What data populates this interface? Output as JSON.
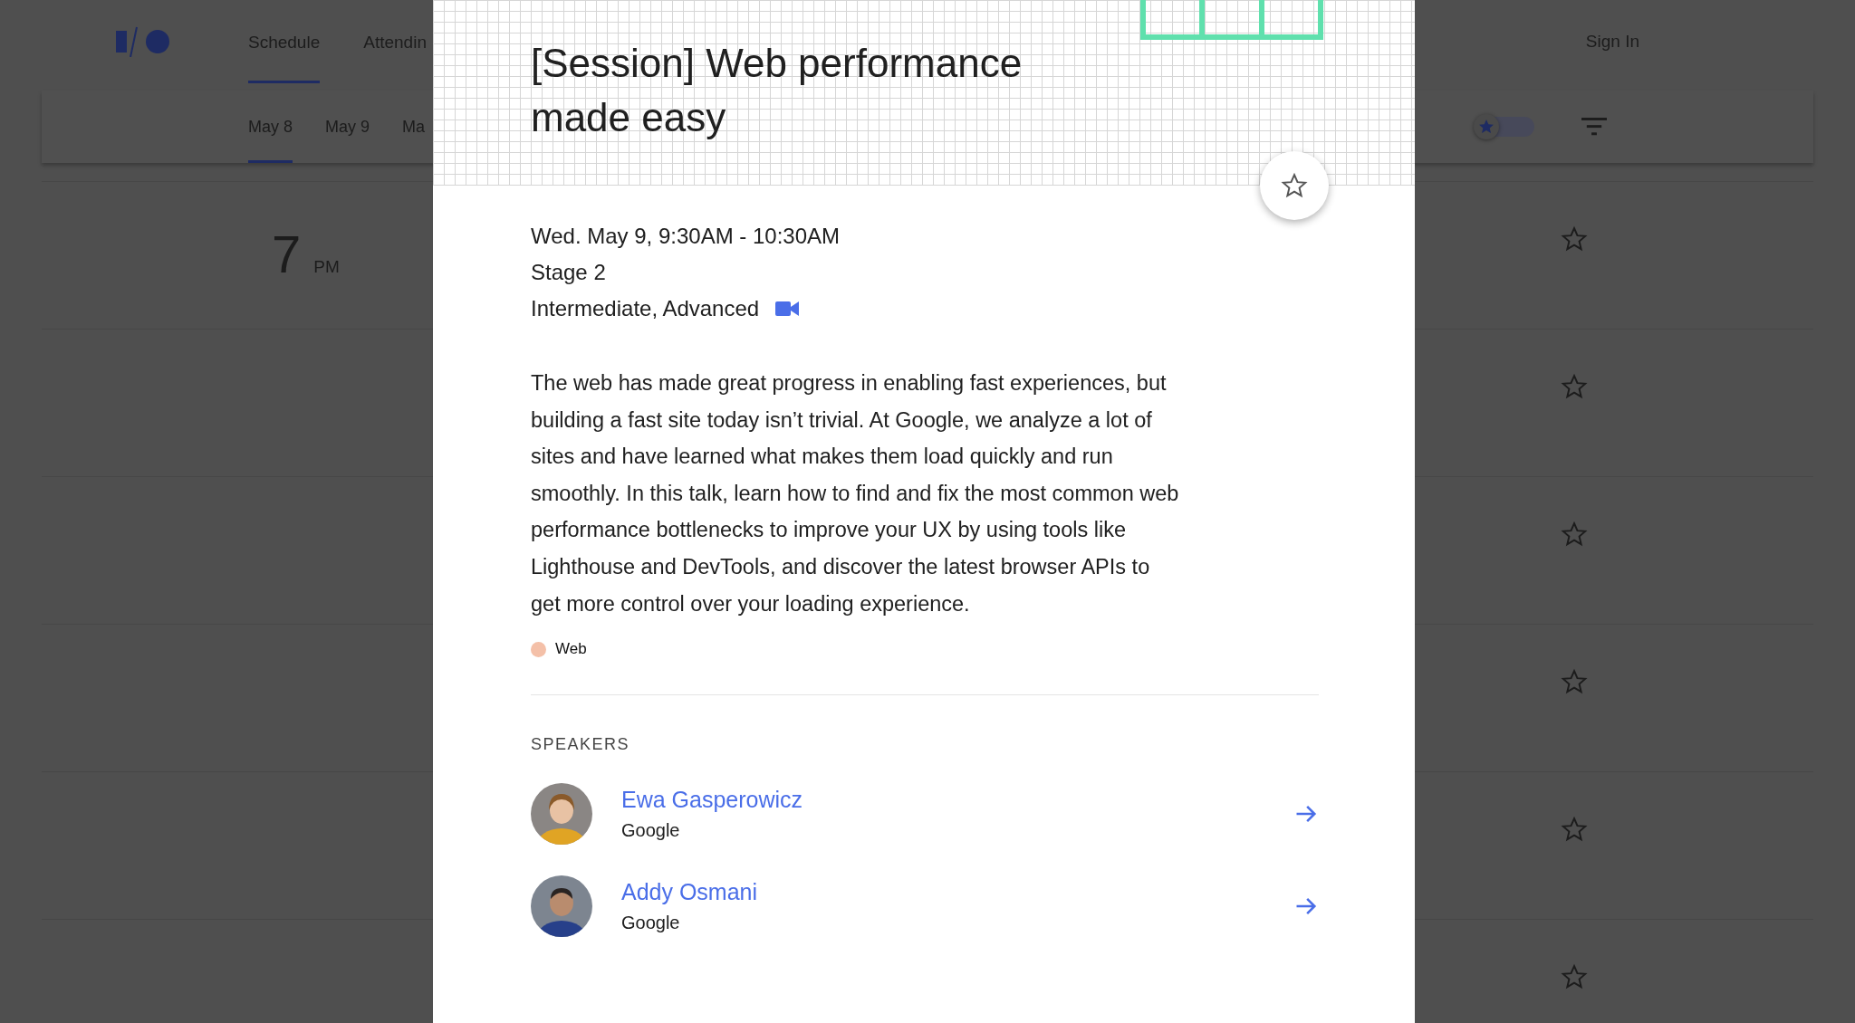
{
  "nav": {
    "tabs": [
      {
        "label": "Schedule",
        "selected": true
      },
      {
        "label": "Attendin",
        "selected": false
      }
    ],
    "sign_in": "Sign In"
  },
  "day_tabs": [
    {
      "label": "May 8",
      "selected": true
    },
    {
      "label": "May 9",
      "selected": false
    },
    {
      "label": "Ma",
      "selected": false
    }
  ],
  "starred_filter": {
    "on": false
  },
  "schedule": {
    "time": "7",
    "period": "PM",
    "rows": [
      {
        "starred": false
      },
      {
        "starred": false
      },
      {
        "starred": false
      },
      {
        "starred": false
      },
      {
        "starred": false
      },
      {
        "starred": false
      }
    ]
  },
  "session": {
    "title": "[Session] Web performance made easy",
    "starred": false,
    "datetime": "Wed. May 9, 9:30AM - 10:30AM",
    "location": "Stage 2",
    "level": "Intermediate, Advanced",
    "has_video": true,
    "description": "The web has made great progress in enabling fast experiences, but building a fast site today isn’t trivial. At Google, we analyze a lot of sites and have learned what makes them load quickly and run smoothly. In this talk, learn how to find and fix the most common web performance bottlenecks to improve your UX by using tools like Lighthouse and DevTools, and discover the latest browser APIs to get more control over your loading experience.",
    "tags": [
      {
        "label": "Web",
        "color": "#f4c0a8"
      }
    ],
    "speakers_heading": "SPEAKERS",
    "speakers": [
      {
        "name": "Ewa Gasperowicz",
        "company": "Google"
      },
      {
        "name": "Addy Osmani",
        "company": "Google"
      }
    ]
  }
}
